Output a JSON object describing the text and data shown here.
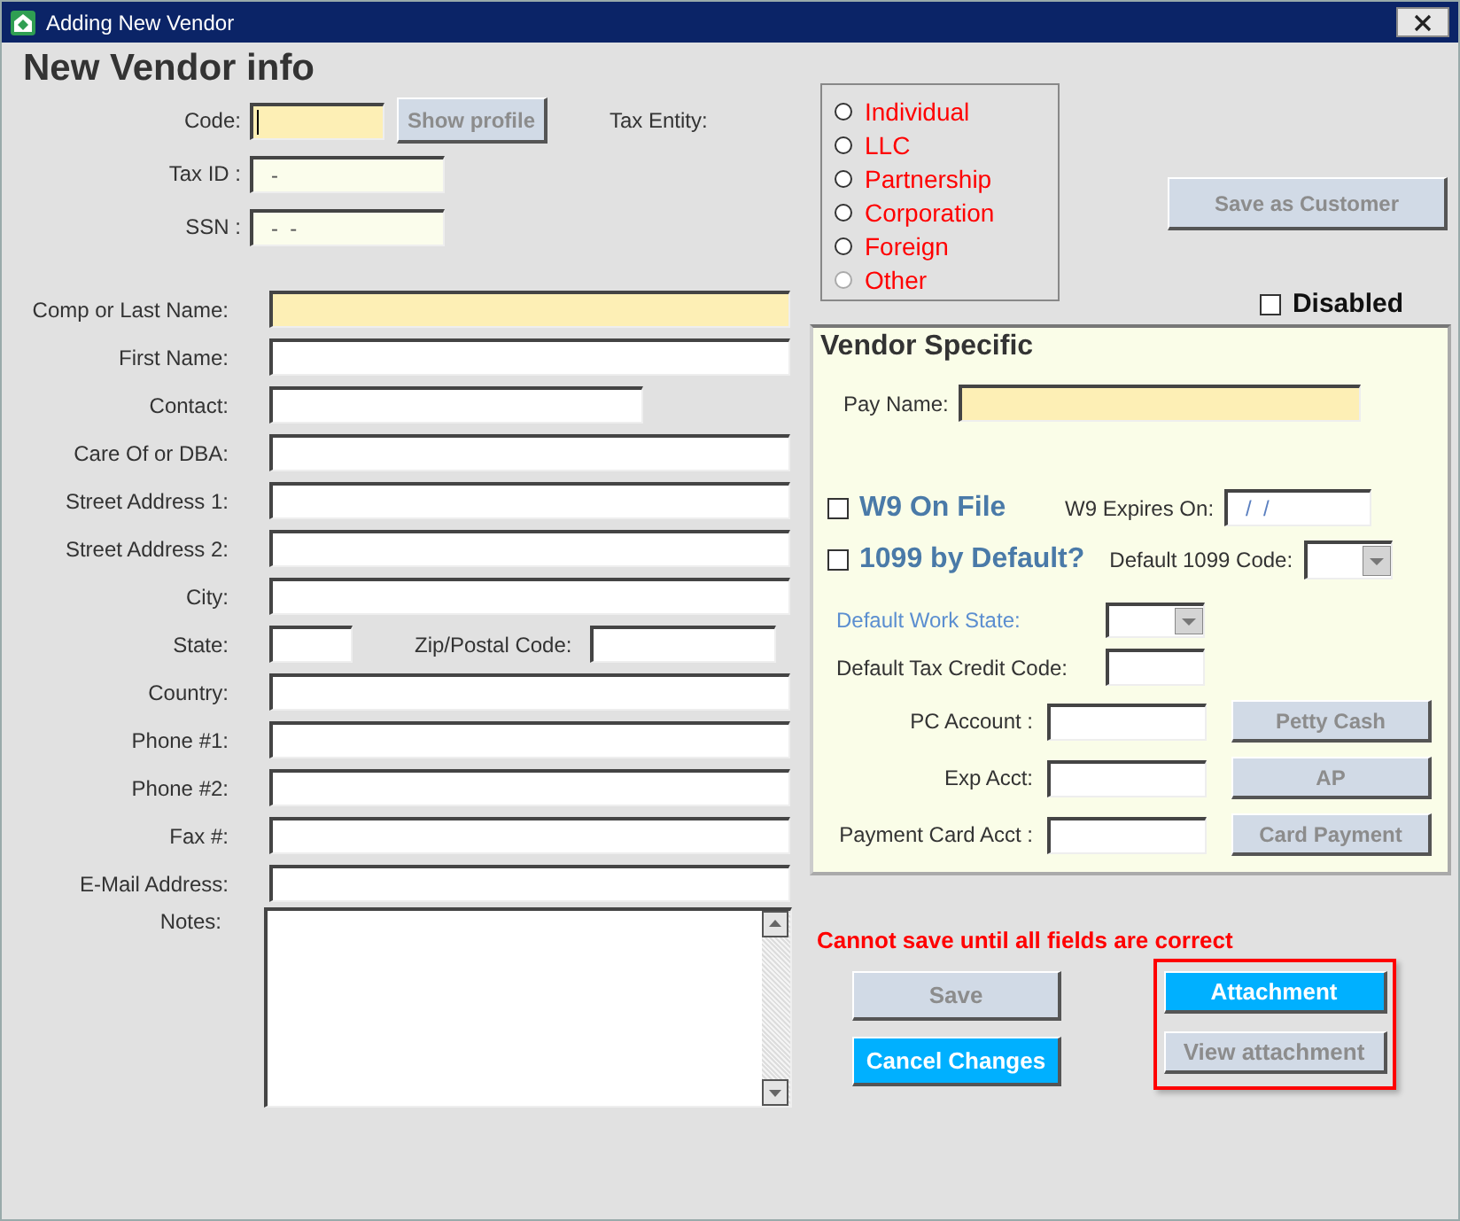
{
  "window": {
    "title": "Adding New Vendor"
  },
  "heading": "New Vendor info",
  "id_fields": [
    {
      "label": "Code:",
      "required": true,
      "focused": true
    },
    {
      "label": "Tax ID :",
      "value": "-",
      "required": false
    },
    {
      "label": "SSN :",
      "value": "-  -",
      "required": false
    }
  ],
  "show_profile_button": {
    "label": "Show profile",
    "disabled": true
  },
  "tax_entity": {
    "label": "Tax Entity:",
    "options": [
      {
        "label": "Individual",
        "selected": false,
        "disabled": false
      },
      {
        "label": "LLC",
        "selected": false,
        "disabled": false
      },
      {
        "label": "Partnership",
        "selected": false,
        "disabled": false
      },
      {
        "label": "Corporation",
        "selected": false,
        "disabled": false
      },
      {
        "label": "Foreign",
        "selected": false,
        "disabled": false
      },
      {
        "label": "Other",
        "selected": false,
        "disabled": true
      }
    ]
  },
  "address_fields": [
    {
      "kind": "full",
      "label": "Comp or Last Name:",
      "required": true
    },
    {
      "kind": "full",
      "label": "First Name:",
      "required": false
    },
    {
      "kind": "short",
      "label": "Contact:",
      "required": false
    },
    {
      "kind": "full",
      "label": "Care Of or DBA:",
      "required": false
    },
    {
      "kind": "full",
      "label": "Street Address 1:",
      "required": false
    },
    {
      "kind": "full",
      "label": "Street Address 2:",
      "required": false
    },
    {
      "kind": "full",
      "label": "City:",
      "required": false
    },
    {
      "kind": "pair",
      "label": "State:",
      "second_label": "Zip/Postal Code:",
      "required": false
    },
    {
      "kind": "full",
      "label": "Country:",
      "required": false
    },
    {
      "kind": "full",
      "label": "Phone #1:",
      "required": false
    },
    {
      "kind": "full",
      "label": "Phone #2:",
      "required": false
    },
    {
      "kind": "full",
      "label": "Fax #:",
      "required": false
    },
    {
      "kind": "full",
      "label": "E-Mail Address:",
      "required": false
    },
    {
      "kind": "notes",
      "label": "Notes:",
      "required": false
    }
  ],
  "save_as_customer_button": {
    "label": "Save as Customer",
    "disabled": true
  },
  "disabled_checkbox": {
    "label": "Disabled",
    "checked": false
  },
  "vendor_specific": {
    "title": "Vendor Specific",
    "pay_name": {
      "label": "Pay Name:",
      "required": true
    },
    "w9_on_file": {
      "label": "W9 On File",
      "checked": false
    },
    "w9_expires": {
      "label": "W9 Expires On:",
      "value": "/  /"
    },
    "default_1099": {
      "label": "1099 by Default?",
      "checked": false
    },
    "default_1099_code": {
      "label": "Default 1099 Code:"
    },
    "default_work_state": {
      "label": "Default Work State:",
      "disabled": true
    },
    "default_tax_credit_code": {
      "label": "Default Tax Credit Code:"
    },
    "accounts": [
      {
        "label": "PC Account :",
        "button": "Petty Cash",
        "disabled": true
      },
      {
        "label": "Exp Acct:",
        "button": "AP",
        "disabled": true
      },
      {
        "label": "Payment Card Acct :",
        "button": "Card Payment",
        "disabled": true
      }
    ]
  },
  "message": "Cannot save until all fields are correct",
  "save_button": {
    "label": "Save",
    "disabled": true
  },
  "cancel_button": {
    "label": "Cancel Changes",
    "disabled": false
  },
  "attachment_group": {
    "outlined": true,
    "buttons": [
      {
        "label": "Attachment",
        "disabled": false
      },
      {
        "label": "View attachment",
        "disabled": true
      }
    ]
  }
}
